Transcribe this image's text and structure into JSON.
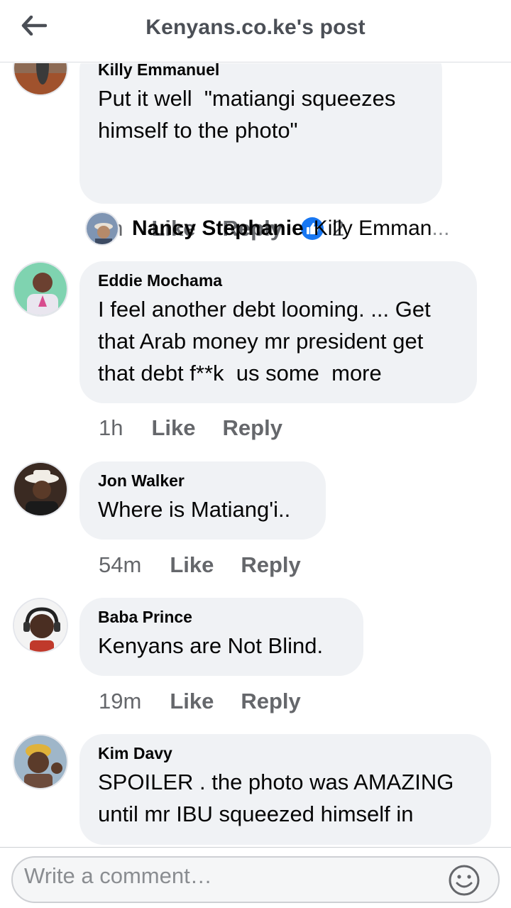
{
  "header": {
    "title": "Kenyans.co.ke's post",
    "back_icon": "arrow-left-icon"
  },
  "comments": [
    {
      "author": "Killy Emmanuel",
      "text": "Put it well  \"matiangi squeezes\nhimself to the photo\"",
      "time": "1h",
      "like": "Like",
      "reply": "Reply",
      "reactions": "2",
      "reply_preview": {
        "name": "Nancy Stephanie",
        "text": "Killy Emman",
        "ellipsis": "..."
      }
    },
    {
      "author": "Eddie Mochama",
      "text": "I feel another debt looming. ... Get\nthat Arab money mr president get\nthat debt f**k  us some  more",
      "time": "1h",
      "like": "Like",
      "reply": "Reply"
    },
    {
      "author": "Jon Walker",
      "text": "Where is Matiang'i..",
      "time": "54m",
      "like": "Like",
      "reply": "Reply"
    },
    {
      "author": "Baba Prince",
      "text": "Kenyans are Not Blind.",
      "time": "19m",
      "like": "Like",
      "reply": "Reply"
    },
    {
      "author": "Kim Davy",
      "text": "SPOILER . the photo was AMAZING\nuntil mr IBU squeezed himself in"
    }
  ],
  "composer": {
    "placeholder": "Write a comment…",
    "emoji_icon": "smiley-icon"
  },
  "colors": {
    "like_blue": "#1877f2",
    "bubble": "#f0f2f5",
    "muted": "#65676b"
  }
}
